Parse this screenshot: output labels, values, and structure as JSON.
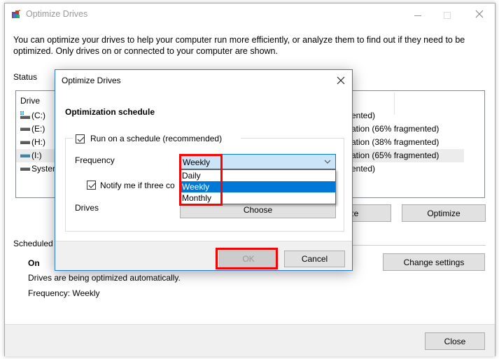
{
  "window": {
    "title": "Optimize Drives",
    "description_line1": "You can optimize your drives to help your computer run more efficiently, or analyze them to find out if they need to be",
    "description_line2": "optimized. Only drives on or connected to your computer are shown.",
    "status_label": "Status",
    "drive_column_header": "Drive",
    "drives": [
      {
        "name": "(C:)",
        "status": "ented)"
      },
      {
        "name": "(E:)",
        "status": "ation (66% fragmented)"
      },
      {
        "name": "(H:)",
        "status": "ation (38% fragmented)"
      },
      {
        "name": "(I:)",
        "status": "ation (65% fragmented)"
      },
      {
        "name": "System",
        "status": "ented)"
      }
    ],
    "analyze_button": "yze",
    "optimize_button": "Optimize",
    "scheduled_label": "Scheduled",
    "schedule_state": "On",
    "schedule_desc": "Drives are being optimized automatically.",
    "schedule_frequency": "Frequency: Weekly",
    "change_settings_button": "Change settings",
    "close_button": "Close"
  },
  "dialog": {
    "title": "Optimize Drives",
    "heading": "Optimization schedule",
    "run_on_schedule_label": "Run on a schedule (recommended)",
    "run_on_schedule_checked": true,
    "frequency_label": "Frequency",
    "frequency_value": "Weekly",
    "frequency_options": [
      "Daily",
      "Weekly",
      "Monthly"
    ],
    "frequency_selected_index": 1,
    "notify_label": "Notify me if three co",
    "notify_checked": true,
    "drives_label": "Drives",
    "choose_button": "Choose",
    "ok_button": "OK",
    "cancel_button": "Cancel"
  },
  "colors": {
    "accent": "#0078d7",
    "highlight": "#ff0000",
    "dialog_border": "#2b7bd4"
  }
}
